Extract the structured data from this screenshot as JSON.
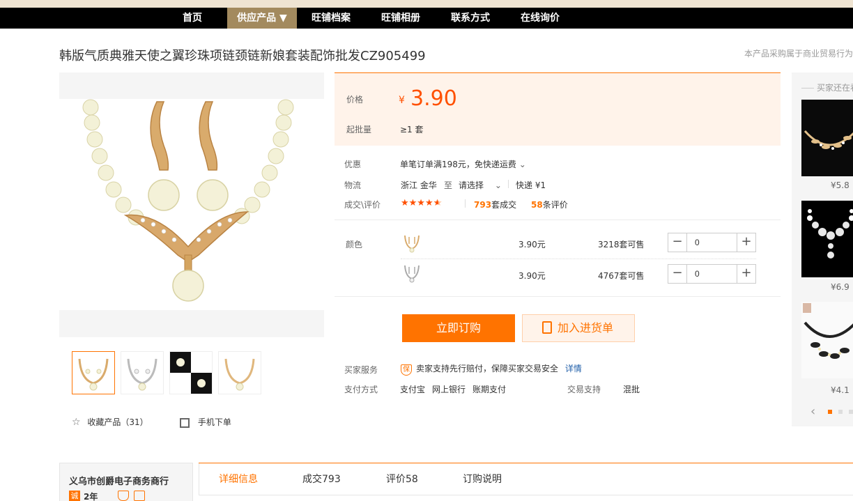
{
  "nav": {
    "items": [
      "首页",
      "供应产品 ▼",
      "旺铺档案",
      "旺铺相册",
      "联系方式",
      "在线询价"
    ]
  },
  "product": {
    "title": "韩版气质典雅天使之翼珍珠项链颈链新娘套装配饰批发CZ905499",
    "note": "本产品采购属于商业贸易行为"
  },
  "gallery": {
    "favorite_label": "收藏产品（31）",
    "mobile_label": "手机下单"
  },
  "price": {
    "label": "价格",
    "currency": "¥",
    "value": "3.90",
    "moq_label": "起批量",
    "moq_value": "≥1 套"
  },
  "promo": {
    "label": "优惠",
    "value": "单笔订单满198元，免快递运费"
  },
  "logistics": {
    "label": "物流",
    "from": "浙江 金华",
    "to_word": "至",
    "select": "请选择",
    "express": "快递 ¥1"
  },
  "deals": {
    "label": "成交\\评价",
    "count": "793",
    "count_unit": "套成交",
    "reviews": "58",
    "reviews_unit": "条评价",
    "rating": 4.5
  },
  "color": {
    "label": "颜色",
    "rows": [
      {
        "price": "3.90元",
        "stock": "3218套可售",
        "qty": "0"
      },
      {
        "price": "3.90元",
        "stock": "4767套可售",
        "qty": "0"
      }
    ]
  },
  "actions": {
    "buy": "立即订购",
    "cart": "加入进货单"
  },
  "service": {
    "label": "买家服务",
    "badge": "保",
    "text": "卖家支持先行赔付，保障买家交易安全",
    "link": "详情"
  },
  "payment": {
    "label": "支付方式",
    "methods": [
      "支付宝",
      "网上银行",
      "账期支付"
    ],
    "support_label": "交易支持",
    "support_value": "混批"
  },
  "side": {
    "title": "买家还在看",
    "prices": [
      "¥5.8",
      "¥6.9",
      "¥4.1"
    ]
  },
  "shop": {
    "name": "义乌市创爵电子商务商行",
    "years": "2年",
    "badge": "诚"
  },
  "tabs": [
    "详细信息",
    "成交793",
    "评价58",
    "订购说明"
  ],
  "colors": {
    "accent": "#ff7300",
    "price": "#ff5000",
    "nav_bg": "#000000",
    "nav_active": "#a38a5e"
  }
}
